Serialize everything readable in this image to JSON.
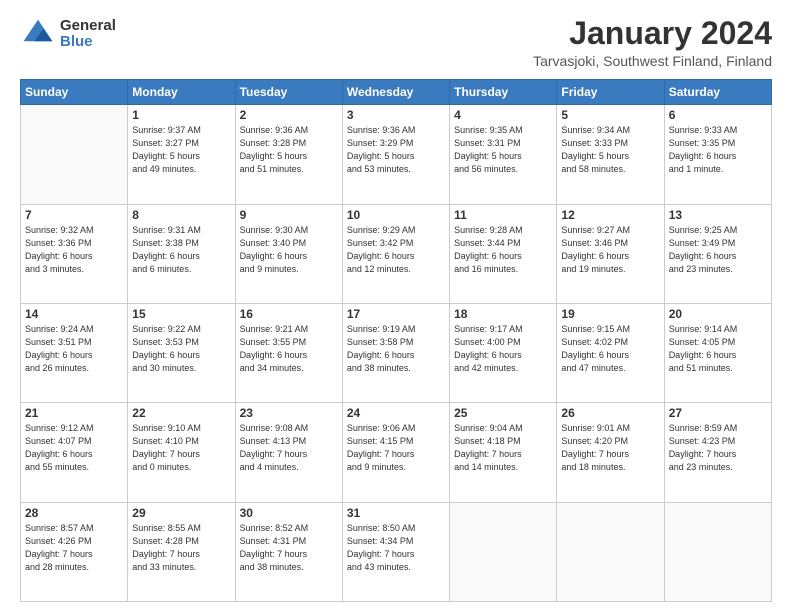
{
  "logo": {
    "general": "General",
    "blue": "Blue"
  },
  "title": "January 2024",
  "location": "Tarvasjoki, Southwest Finland, Finland",
  "days_of_week": [
    "Sunday",
    "Monday",
    "Tuesday",
    "Wednesday",
    "Thursday",
    "Friday",
    "Saturday"
  ],
  "weeks": [
    [
      {
        "num": "",
        "info": ""
      },
      {
        "num": "1",
        "info": "Sunrise: 9:37 AM\nSunset: 3:27 PM\nDaylight: 5 hours\nand 49 minutes."
      },
      {
        "num": "2",
        "info": "Sunrise: 9:36 AM\nSunset: 3:28 PM\nDaylight: 5 hours\nand 51 minutes."
      },
      {
        "num": "3",
        "info": "Sunrise: 9:36 AM\nSunset: 3:29 PM\nDaylight: 5 hours\nand 53 minutes."
      },
      {
        "num": "4",
        "info": "Sunrise: 9:35 AM\nSunset: 3:31 PM\nDaylight: 5 hours\nand 56 minutes."
      },
      {
        "num": "5",
        "info": "Sunrise: 9:34 AM\nSunset: 3:33 PM\nDaylight: 5 hours\nand 58 minutes."
      },
      {
        "num": "6",
        "info": "Sunrise: 9:33 AM\nSunset: 3:35 PM\nDaylight: 6 hours\nand 1 minute."
      }
    ],
    [
      {
        "num": "7",
        "info": "Sunrise: 9:32 AM\nSunset: 3:36 PM\nDaylight: 6 hours\nand 3 minutes."
      },
      {
        "num": "8",
        "info": "Sunrise: 9:31 AM\nSunset: 3:38 PM\nDaylight: 6 hours\nand 6 minutes."
      },
      {
        "num": "9",
        "info": "Sunrise: 9:30 AM\nSunset: 3:40 PM\nDaylight: 6 hours\nand 9 minutes."
      },
      {
        "num": "10",
        "info": "Sunrise: 9:29 AM\nSunset: 3:42 PM\nDaylight: 6 hours\nand 12 minutes."
      },
      {
        "num": "11",
        "info": "Sunrise: 9:28 AM\nSunset: 3:44 PM\nDaylight: 6 hours\nand 16 minutes."
      },
      {
        "num": "12",
        "info": "Sunrise: 9:27 AM\nSunset: 3:46 PM\nDaylight: 6 hours\nand 19 minutes."
      },
      {
        "num": "13",
        "info": "Sunrise: 9:25 AM\nSunset: 3:49 PM\nDaylight: 6 hours\nand 23 minutes."
      }
    ],
    [
      {
        "num": "14",
        "info": "Sunrise: 9:24 AM\nSunset: 3:51 PM\nDaylight: 6 hours\nand 26 minutes."
      },
      {
        "num": "15",
        "info": "Sunrise: 9:22 AM\nSunset: 3:53 PM\nDaylight: 6 hours\nand 30 minutes."
      },
      {
        "num": "16",
        "info": "Sunrise: 9:21 AM\nSunset: 3:55 PM\nDaylight: 6 hours\nand 34 minutes."
      },
      {
        "num": "17",
        "info": "Sunrise: 9:19 AM\nSunset: 3:58 PM\nDaylight: 6 hours\nand 38 minutes."
      },
      {
        "num": "18",
        "info": "Sunrise: 9:17 AM\nSunset: 4:00 PM\nDaylight: 6 hours\nand 42 minutes."
      },
      {
        "num": "19",
        "info": "Sunrise: 9:15 AM\nSunset: 4:02 PM\nDaylight: 6 hours\nand 47 minutes."
      },
      {
        "num": "20",
        "info": "Sunrise: 9:14 AM\nSunset: 4:05 PM\nDaylight: 6 hours\nand 51 minutes."
      }
    ],
    [
      {
        "num": "21",
        "info": "Sunrise: 9:12 AM\nSunset: 4:07 PM\nDaylight: 6 hours\nand 55 minutes."
      },
      {
        "num": "22",
        "info": "Sunrise: 9:10 AM\nSunset: 4:10 PM\nDaylight: 7 hours\nand 0 minutes."
      },
      {
        "num": "23",
        "info": "Sunrise: 9:08 AM\nSunset: 4:13 PM\nDaylight: 7 hours\nand 4 minutes."
      },
      {
        "num": "24",
        "info": "Sunrise: 9:06 AM\nSunset: 4:15 PM\nDaylight: 7 hours\nand 9 minutes."
      },
      {
        "num": "25",
        "info": "Sunrise: 9:04 AM\nSunset: 4:18 PM\nDaylight: 7 hours\nand 14 minutes."
      },
      {
        "num": "26",
        "info": "Sunrise: 9:01 AM\nSunset: 4:20 PM\nDaylight: 7 hours\nand 18 minutes."
      },
      {
        "num": "27",
        "info": "Sunrise: 8:59 AM\nSunset: 4:23 PM\nDaylight: 7 hours\nand 23 minutes."
      }
    ],
    [
      {
        "num": "28",
        "info": "Sunrise: 8:57 AM\nSunset: 4:26 PM\nDaylight: 7 hours\nand 28 minutes."
      },
      {
        "num": "29",
        "info": "Sunrise: 8:55 AM\nSunset: 4:28 PM\nDaylight: 7 hours\nand 33 minutes."
      },
      {
        "num": "30",
        "info": "Sunrise: 8:52 AM\nSunset: 4:31 PM\nDaylight: 7 hours\nand 38 minutes."
      },
      {
        "num": "31",
        "info": "Sunrise: 8:50 AM\nSunset: 4:34 PM\nDaylight: 7 hours\nand 43 minutes."
      },
      {
        "num": "",
        "info": ""
      },
      {
        "num": "",
        "info": ""
      },
      {
        "num": "",
        "info": ""
      }
    ]
  ]
}
